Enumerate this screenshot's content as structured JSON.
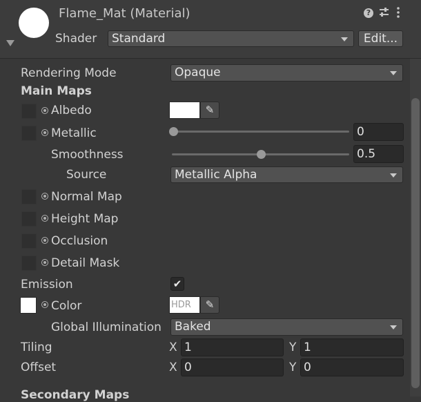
{
  "header": {
    "title": "Flame_Mat (Material)",
    "shader_label": "Shader",
    "shader_value": "Standard",
    "edit_button": "Edit..."
  },
  "rendering_mode": {
    "label": "Rendering Mode",
    "value": "Opaque"
  },
  "main_maps": {
    "heading": "Main Maps",
    "albedo_label": "Albedo",
    "metallic_label": "Metallic",
    "metallic_value": "0",
    "metallic_level": 0,
    "smoothness_label": "Smoothness",
    "smoothness_value": "0.5",
    "smoothness_level": 0.5,
    "source_label": "Source",
    "source_value": "Metallic Alpha",
    "normal_map_label": "Normal Map",
    "height_map_label": "Height Map",
    "occlusion_label": "Occlusion",
    "detail_mask_label": "Detail Mask"
  },
  "emission": {
    "label": "Emission",
    "checked": true,
    "color_label": "Color",
    "hdr_text": "HDR",
    "gi_label": "Global Illumination",
    "gi_value": "Baked"
  },
  "tiling": {
    "label": "Tiling",
    "x_axis": "X",
    "x": "1",
    "y_axis": "Y",
    "y": "1"
  },
  "offset": {
    "label": "Offset",
    "x_axis": "X",
    "x": "0",
    "y_axis": "Y",
    "y": "0"
  },
  "secondary_maps": {
    "heading": "Secondary Maps"
  },
  "icons": {
    "help": "question-icon",
    "presets": "sliders-icon",
    "menu": "kebab-menu-icon",
    "eyedropper": "eyedropper-icon",
    "check": "checkmark-icon"
  },
  "colors": {
    "panel_bg": "#383838",
    "header_bg": "#3c3c3c",
    "albedo_color": "#ffffff",
    "emission_color": "#ffffff"
  }
}
